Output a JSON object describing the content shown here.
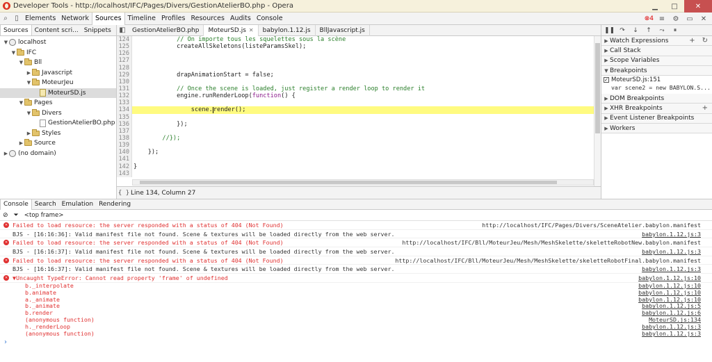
{
  "window": {
    "title": "Developer Tools - http://localhost/IFC/Pages/Divers/GestionAtelierBO.php - Opera"
  },
  "toolbar": {
    "panels": [
      "Elements",
      "Network",
      "Sources",
      "Timeline",
      "Profiles",
      "Resources",
      "Audits",
      "Console"
    ],
    "active_panel": "Sources",
    "error_count": "4"
  },
  "navigator": {
    "tabs": [
      "Sources",
      "Content scri...",
      "Snippets"
    ],
    "tree": [
      {
        "label": "localhost",
        "depth": 0,
        "kind": "globe",
        "open": true
      },
      {
        "label": "IFC",
        "depth": 1,
        "kind": "folder",
        "open": true
      },
      {
        "label": "Bll",
        "depth": 2,
        "kind": "folder",
        "open": true
      },
      {
        "label": "Javascript",
        "depth": 3,
        "kind": "folder",
        "open": false
      },
      {
        "label": "MoteurJeu",
        "depth": 3,
        "kind": "folder",
        "open": true
      },
      {
        "label": "MoteurSD.js",
        "depth": 4,
        "kind": "js",
        "selected": true
      },
      {
        "label": "Pages",
        "depth": 2,
        "kind": "folder",
        "open": true
      },
      {
        "label": "Divers",
        "depth": 3,
        "kind": "folder",
        "open": true
      },
      {
        "label": "GestionAtelierBO.php",
        "depth": 4,
        "kind": "file"
      },
      {
        "label": "Styles",
        "depth": 3,
        "kind": "folder",
        "open": false
      },
      {
        "label": "Source",
        "depth": 2,
        "kind": "folder",
        "open": false
      },
      {
        "label": "(no domain)",
        "depth": 0,
        "kind": "globe",
        "open": false
      }
    ]
  },
  "editor": {
    "tabs": [
      "GestionAtelierBO.php",
      "MoteurSD.js",
      "babylon.1.12.js",
      "BllJavascript.js"
    ],
    "active_tab": "MoteurSD.js",
    "status": "Line 134, Column 27",
    "lines": [
      {
        "n": "124",
        "indent": "            ",
        "text": "// On importe tous les squelettes sous la scène",
        "cls": "comment"
      },
      {
        "n": "125",
        "indent": "            ",
        "text": "createAllSkeletons(listeParamsSkel);",
        "cls": ""
      },
      {
        "n": "126",
        "indent": "",
        "text": "",
        "cls": ""
      },
      {
        "n": "127",
        "indent": "",
        "text": "",
        "cls": ""
      },
      {
        "n": "128",
        "indent": "",
        "text": "",
        "cls": ""
      },
      {
        "n": "129",
        "indent": "            ",
        "text": "drapAnimationStart = false;",
        "cls": ""
      },
      {
        "n": "130",
        "indent": "",
        "text": "",
        "cls": ""
      },
      {
        "n": "131",
        "indent": "            ",
        "text": "// Once the scene is loaded, just register a render loop to render it",
        "cls": "comment"
      },
      {
        "n": "132",
        "indent": "            ",
        "text": "engine.runRenderLoop(function() {",
        "cls": ""
      },
      {
        "n": "133",
        "indent": "",
        "text": "",
        "cls": ""
      },
      {
        "n": "134",
        "indent": "                ",
        "text": "scene.render();",
        "cls": "",
        "hl": true
      },
      {
        "n": "135",
        "indent": "",
        "text": "",
        "cls": ""
      },
      {
        "n": "136",
        "indent": "            ",
        "text": "});",
        "cls": ""
      },
      {
        "n": "137",
        "indent": "",
        "text": "",
        "cls": ""
      },
      {
        "n": "138",
        "indent": "        ",
        "text": "//});",
        "cls": "comment"
      },
      {
        "n": "139",
        "indent": "",
        "text": "",
        "cls": ""
      },
      {
        "n": "140",
        "indent": "    ",
        "text": "});",
        "cls": ""
      },
      {
        "n": "141",
        "indent": "",
        "text": "",
        "cls": ""
      },
      {
        "n": "142",
        "indent": "",
        "text": "}",
        "cls": ""
      },
      {
        "n": "143",
        "indent": "",
        "text": "",
        "cls": ""
      }
    ]
  },
  "sidebar": {
    "sections": [
      {
        "label": "Watch Expressions",
        "open": false,
        "actions": [
          "+",
          "↻"
        ]
      },
      {
        "label": "Call Stack",
        "open": false
      },
      {
        "label": "Scope Variables",
        "open": false
      },
      {
        "label": "Breakpoints",
        "open": true
      }
    ],
    "breakpoint": {
      "file": "MoteurSD.js:151",
      "snippet": "var scene2 = new BABYLON.S..."
    },
    "sections2": [
      {
        "label": "DOM Breakpoints",
        "open": false
      },
      {
        "label": "XHR Breakpoints",
        "open": false,
        "actions": [
          "+"
        ]
      },
      {
        "label": "Event Listener Breakpoints",
        "open": false
      },
      {
        "label": "Workers",
        "open": false
      }
    ]
  },
  "drawer": {
    "tabs": [
      "Console",
      "Search",
      "Emulation",
      "Rendering"
    ],
    "active_tab": "Console",
    "frame": "<top frame>"
  },
  "console": {
    "messages": [
      {
        "type": "err",
        "text": "Failed to load resource: the server responded with a status of 404 (Not Found)",
        "src": "http://localhost/IFC/Pages/Divers/SceneAtelier.babylon.manifest",
        "link": false
      },
      {
        "type": "log",
        "text": "BJS - [16:16:36]: Valid manifest file not found. Scene & textures will be loaded directly from the web server.",
        "src": "babylon.1.12.js:3",
        "link": true
      },
      {
        "type": "err",
        "text": "Failed to load resource: the server responded with a status of 404 (Not Found)",
        "src": "http://localhost/IFC/Bll/MoteurJeu/Mesh/MeshSkelette/skeletteRobotNew.babylon.manifest",
        "link": false
      },
      {
        "type": "log",
        "text": "BJS - [16:16:37]: Valid manifest file not found. Scene & textures will be loaded directly from the web server.",
        "src": "babylon.1.12.js:3",
        "link": true
      },
      {
        "type": "err",
        "text": "Failed to load resource: the server responded with a status of 404 (Not Found)",
        "src": "http://localhost/IFC/Bll/MoteurJeu/Mesh/MeshSkelette/skeletteRobotFinal.babylon.manifest",
        "link": false
      },
      {
        "type": "log",
        "text": "BJS - [16:16:37]: Valid manifest file not found. Scene & textures will be loaded directly from the web server.",
        "src": "babylon.1.12.js:3",
        "link": true
      },
      {
        "type": "err",
        "text": "▼Uncaught TypeError: Cannot read property 'frame' of undefined",
        "src": "babylon.1.12.js:10",
        "link": true
      }
    ],
    "stack": [
      {
        "fn": "b._interpolate",
        "src": "babylon.1.12.js:10"
      },
      {
        "fn": "b.animate",
        "src": "babylon.1.12.js:10"
      },
      {
        "fn": "a._animate",
        "src": "babylon.1.12.js:10"
      },
      {
        "fn": "b._animate",
        "src": "babylon.1.12.js:5"
      },
      {
        "fn": "b.render",
        "src": "babylon.1.12.js:6"
      },
      {
        "fn": "(anonymous function)",
        "src": "MoteurSD.js:134"
      },
      {
        "fn": "h._renderLoop",
        "src": "babylon.1.12.js:3"
      },
      {
        "fn": "(anonymous function)",
        "src": "babylon.1.12.js:3"
      }
    ],
    "prompt": "›"
  }
}
